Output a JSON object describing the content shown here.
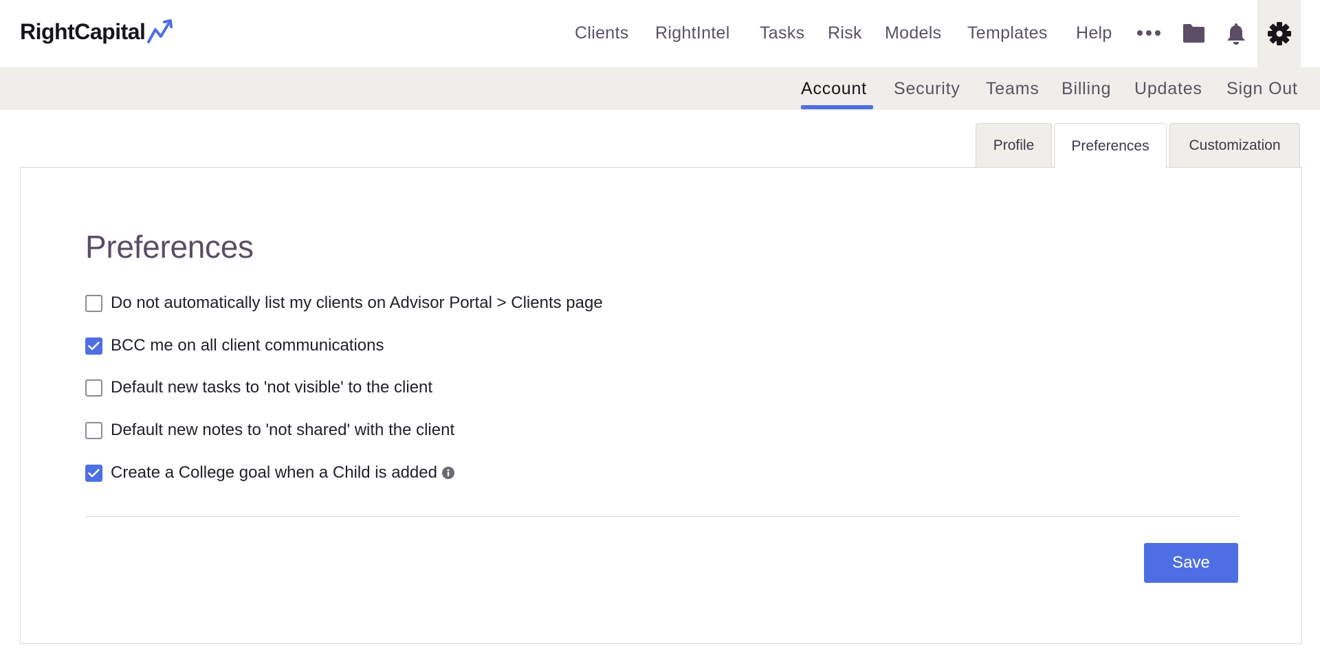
{
  "brand": {
    "name": "RightCapital",
    "accent": "#4d6fe3"
  },
  "top_nav": {
    "items": [
      "Clients",
      "RightIntel",
      "Tasks",
      "Risk",
      "Models",
      "Templates",
      "Help"
    ],
    "icons": [
      "more-icon",
      "folder-icon",
      "bell-icon",
      "gear-icon"
    ]
  },
  "sub_nav": {
    "items": [
      "Account",
      "Security",
      "Teams",
      "Billing",
      "Updates",
      "Sign Out"
    ],
    "active": "Account"
  },
  "tabs": {
    "items": [
      "Profile",
      "Preferences",
      "Customization"
    ],
    "active": "Preferences"
  },
  "panel": {
    "title": "Preferences",
    "options": [
      {
        "label": "Do not automatically list my clients on Advisor Portal > Clients page",
        "checked": false
      },
      {
        "label": "BCC me on all client communications",
        "checked": true
      },
      {
        "label": "Default new tasks to 'not visible' to the client",
        "checked": false
      },
      {
        "label": "Default new notes to 'not shared' with the client",
        "checked": false
      },
      {
        "label": "Create a College goal when a Child is added",
        "checked": true,
        "info_icon": "info-icon"
      }
    ],
    "save_label": "Save"
  }
}
